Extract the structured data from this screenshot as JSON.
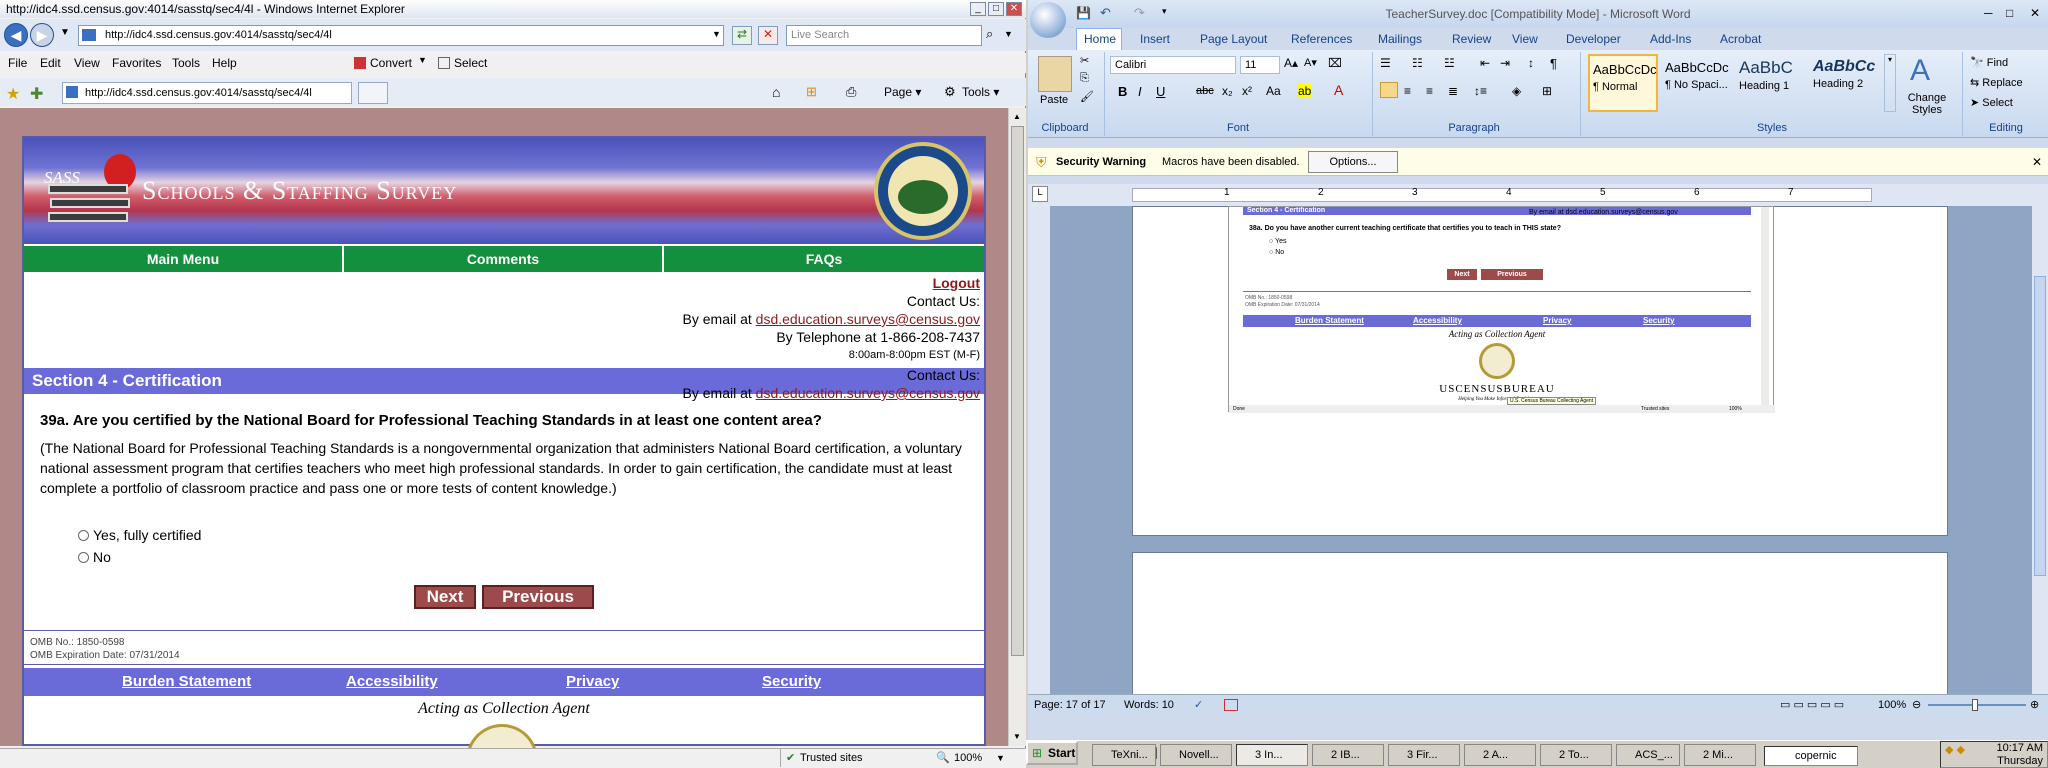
{
  "ie": {
    "title": "http://idc4.ssd.census.gov:4014/sasstq/sec4/4l - Windows Internet Explorer",
    "address": "http://idc4.ssd.census.gov:4014/sasstq/sec4/4l",
    "search_placeholder": "Live Search",
    "menu": [
      "File",
      "Edit",
      "View",
      "Favorites",
      "Tools",
      "Help"
    ],
    "convert_label": "Convert",
    "select_label": "Select",
    "tab_title": "http://idc4.ssd.census.gov:4014/sasstq/sec4/4l",
    "cmd_page": "Page",
    "cmd_tools": "Tools",
    "status_zone": "Trusted sites",
    "status_zoom": "100%"
  },
  "survey": {
    "logo_text": "SASS",
    "banner_title": "Schools & Staffing Survey",
    "seal_text": "DEPARTMENT OF EDUCATION",
    "nav": [
      "Main Menu",
      "Comments",
      "FAQs"
    ],
    "logout": "Logout",
    "contact_heading": "Contact Us:",
    "email_prefix": "By email at ",
    "email": "dsd.education.surveys@census.gov",
    "phone": "By Telephone at 1-866-208-7437",
    "hours": "8:00am-8:00pm EST (M-F)",
    "section_title": "Section 4 - Certification",
    "question": "39a. Are you certified by the National Board for Professional Teaching Standards in at least one content area?",
    "question_desc": "(The National Board for Professional Teaching Standards is a nongovernmental organization that administers National Board certification, a voluntary national assessment program that certifies teachers who meet high professional standards. In order to gain certification, the candidate must at least complete a portfolio of classroom practice and pass one or more tests of content knowledge.)",
    "options": [
      "Yes, fully certified",
      "No"
    ],
    "next": "Next",
    "previous": "Previous",
    "omb_no": "OMB No.: 1850-0598",
    "omb_exp": "OMB Expiration Date: 07/31/2014",
    "footer_links": [
      "Burden Statement",
      "Accessibility",
      "Privacy",
      "Security"
    ],
    "agent": "Acting as Collection Agent"
  },
  "word": {
    "title": "TeacherSurvey.doc [Compatibility Mode] - Microsoft Word",
    "tabs": [
      "Home",
      "Insert",
      "Page Layout",
      "References",
      "Mailings",
      "Review",
      "View",
      "Developer",
      "Add-Ins",
      "Acrobat"
    ],
    "font_name": "Calibri",
    "font_size": "11",
    "groups": [
      "Clipboard",
      "Font",
      "Paragraph",
      "Styles",
      "Editing"
    ],
    "paste": "Paste",
    "styles": [
      {
        "preview": "AaBbCcDc",
        "name": "¶ Normal"
      },
      {
        "preview": "AaBbCcDc",
        "name": "¶ No Spaci..."
      },
      {
        "preview": "AaBbC",
        "name": "Heading 1"
      },
      {
        "preview": "AaBbCc",
        "name": "Heading 2"
      }
    ],
    "change_styles": "Change Styles",
    "find": "Find",
    "replace": "Replace",
    "select": "Select",
    "security_warning": "Security Warning",
    "macros_text": "Macros have been disabled.",
    "options_button": "Options...",
    "ruler_numbers": [
      "1",
      "2",
      "3",
      "4",
      "5",
      "6",
      "7"
    ],
    "embedded": {
      "section_title": "Section 4 - Certification",
      "email_line": "By email at dsd.education.surveys@census.gov",
      "question": "38a. Do you have another current teaching certificate that certifies you to teach in THIS state?",
      "options": [
        "Yes",
        "No"
      ],
      "next": "Next",
      "previous": "Previous",
      "omb_no": "OMB No.: 1850-0598",
      "omb_exp": "OMB Expiration Date: 07/31/2014",
      "footer_links": [
        "Burden Statement",
        "Accessibility",
        "Privacy",
        "Security"
      ],
      "agent": "Acting as Collection Agent",
      "census": "USCENSUSBUREAU",
      "census_tag": "Helping You Make Informed Decisions",
      "tooltip": "U.S. Census Bureau Collecting Agent",
      "status_done": "Done",
      "status_zone": "Trusted sites",
      "status_zoom": "100%"
    },
    "status_page": "Page: 17 of 17",
    "status_words": "Words: 10",
    "zoom": "100%"
  },
  "taskbar": {
    "start": "Start",
    "tasks": [
      "TeXni...",
      "Novell...",
      "3 In...",
      "2 IB...",
      "3 Fir...",
      "2 A...",
      "2 To...",
      "ACS_...",
      "2 Mi..."
    ],
    "search_text": "copernic",
    "time": "10:17 AM",
    "day": "Thursday"
  }
}
